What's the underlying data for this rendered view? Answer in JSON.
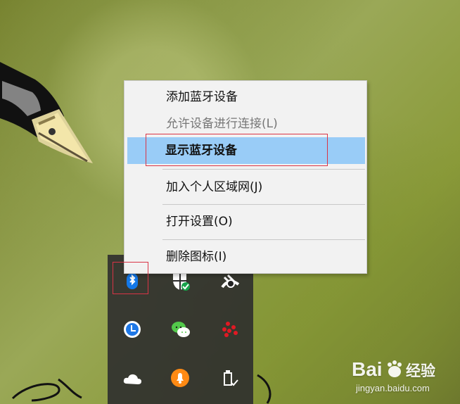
{
  "context_menu": {
    "items": [
      {
        "label": "添加蓝牙设备",
        "state": "enabled"
      },
      {
        "label": "允许设备进行连接(L)",
        "state": "disabled"
      },
      {
        "label": "显示蓝牙设备",
        "state": "selected"
      },
      {
        "label": "加入个人区域网(J)",
        "state": "enabled"
      },
      {
        "label": "打开设置(O)",
        "state": "enabled"
      },
      {
        "label": "删除图标(I)",
        "state": "enabled"
      }
    ],
    "selected_item": "显示蓝牙设备"
  },
  "tray": {
    "icons": [
      "bluetooth-icon",
      "windows-defender-icon",
      "satellite-icon",
      "clock-icon",
      "wechat-icon",
      "dots-network-icon",
      "onedrive-icon",
      "notification-bell-icon",
      "usb-eject-icon"
    ]
  },
  "watermark": {
    "brand": "Bai 经验",
    "url": "jingyan.baidu.com"
  },
  "colors": {
    "selection_background": "#99ccf7",
    "annotation_red": "#d93446",
    "tray_background": "#2e2e2e",
    "menu_background": "#f2f2f2",
    "bluetooth_blue": "#1478e8"
  }
}
